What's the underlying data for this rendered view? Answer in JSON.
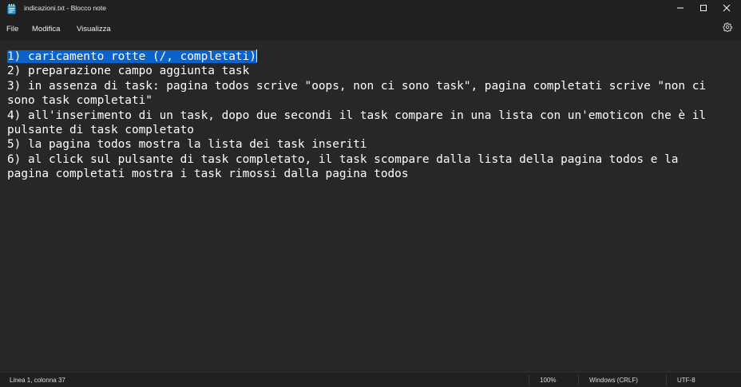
{
  "window": {
    "title": "indicazioni.txt - Blocco note"
  },
  "menu": {
    "file": "File",
    "modifica": "Modifica",
    "visualizza": "Visualizza"
  },
  "icons": {
    "app": "notepad-icon",
    "minimize": "minimize-icon",
    "maximize": "maximize-icon",
    "close": "close-icon",
    "settings": "gear-icon"
  },
  "editor": {
    "selected_text": "1) caricamento rotte (/, completati)",
    "lines": [
      "2) preparazione campo aggiunta task",
      "3) in assenza di task: pagina todos scrive \"oops, non ci sono task\", pagina completati scrive \"non ci",
      "sono task completati\"",
      "4) all'inserimento di un task, dopo due secondi il task compare in una lista con un'emoticon che è il",
      "pulsante di task completato",
      "5) la pagina todos mostra la lista dei task inseriti",
      "6) al click sul pulsante di task completato, il task scompare dalla lista della pagina todos e la",
      "pagina completati mostra i task rimossi dalla pagina todos"
    ]
  },
  "status": {
    "position": "Linea 1, colonna 37",
    "zoom": "100%",
    "line_ending": "Windows (CRLF)",
    "encoding": "UTF-8"
  },
  "colors": {
    "titlebar_bg": "#202020",
    "editor_bg": "#272727",
    "selection": "#0b62cb",
    "text": "#ffffff"
  }
}
